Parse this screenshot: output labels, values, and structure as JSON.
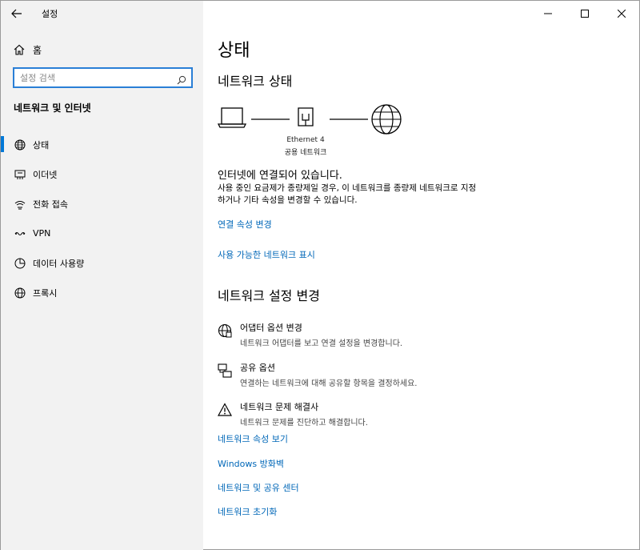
{
  "app": {
    "title": "설정"
  },
  "sidebar": {
    "home_label": "홈",
    "search_placeholder": "설정 검색",
    "section_title": "네트워크 및 인터넷",
    "items": [
      {
        "label": "상태",
        "icon": "globe-status-icon",
        "active": true
      },
      {
        "label": "이더넷",
        "icon": "ethernet-icon",
        "active": false
      },
      {
        "label": "전화 접속",
        "icon": "dialup-icon",
        "active": false
      },
      {
        "label": "VPN",
        "icon": "vpn-icon",
        "active": false
      },
      {
        "label": "데이터 사용량",
        "icon": "data-usage-icon",
        "active": false
      },
      {
        "label": "프록시",
        "icon": "globe-icon",
        "active": false
      }
    ]
  },
  "main": {
    "title": "상태",
    "network_status_heading": "네트워크 상태",
    "diagram": {
      "adapter_name": "Ethernet 4",
      "network_name": "공용 네트워크"
    },
    "status_text": "인터넷에 연결되어 있습니다.",
    "description": "사용 중인 요금제가 종량제일 경우, 이 네트워크를 종량제 네트워크로 지정하거나 기타 속성을 변경할 수 있습니다.",
    "links_top": [
      "연결 속성 변경",
      "사용 가능한 네트워크 표시"
    ],
    "change_heading": "네트워크 설정 변경",
    "options": [
      {
        "title": "어댑터 옵션 변경",
        "desc": "네트워크 어댑터를 보고 연결 설정을 변경합니다.",
        "icon": "adapter-icon"
      },
      {
        "title": "공유 옵션",
        "desc": "연결하는 네트워크에 대해 공유할 항목을 결정하세요.",
        "icon": "sharing-icon"
      },
      {
        "title": "네트워크 문제 해결사",
        "desc": "네트워크 문제를 진단하고 해결합니다.",
        "icon": "warning-icon"
      }
    ],
    "links_bottom": [
      "네트워크 속성 보기",
      "Windows 방화벽",
      "네트워크 및 공유 센터",
      "네트워크 초기화"
    ]
  }
}
